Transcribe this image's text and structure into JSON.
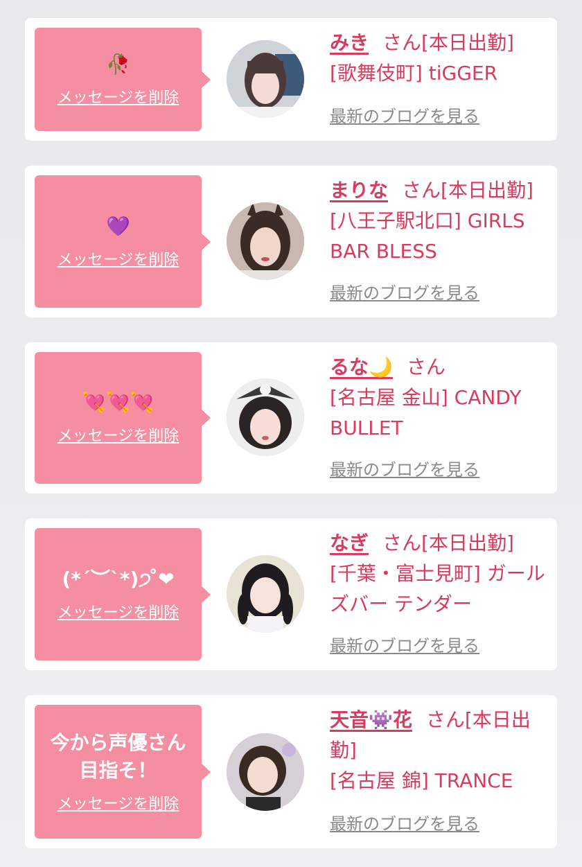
{
  "colors": {
    "accent": "#d93a5e",
    "bubble": "#f58ea0",
    "link_gray": "#8a8a8a"
  },
  "messages": [
    {
      "message": "🥀",
      "delete_label": "メッセージを削除",
      "cast_name": "みき",
      "suffix": "さん[本日出勤]",
      "shop": "[歌舞伎町] tiGGER",
      "blog_label": "最新のブログを見る"
    },
    {
      "message": "💜",
      "delete_label": "メッセージを削除",
      "cast_name": "まりな",
      "suffix": "さん[本日出勤]",
      "shop": "[八王子駅北口] GIRLS BAR BLESS",
      "blog_label": "最新のブログを見る"
    },
    {
      "message": "💘💘💘",
      "delete_label": "メッセージを削除",
      "cast_name": "るな🌙",
      "suffix": "さん",
      "shop": "[名古屋 金山] CANDY BULLET",
      "blog_label": "最新のブログを見る"
    },
    {
      "message": "(*´︶`*)੭ ̊❤",
      "delete_label": "メッセージを削除",
      "cast_name": "なぎ",
      "suffix": "さん[本日出勤]",
      "shop": "[千葉・富士見町] ガールズバー テンダー",
      "blog_label": "最新のブログを見る"
    },
    {
      "message": "今から声優さん目指そ！",
      "delete_label": "メッセージを削除",
      "cast_name": "天音👾花",
      "suffix": "さん[本日出勤]",
      "shop": "[名古屋 錦] TRANCE",
      "blog_label": "最新のブログを見る"
    }
  ]
}
